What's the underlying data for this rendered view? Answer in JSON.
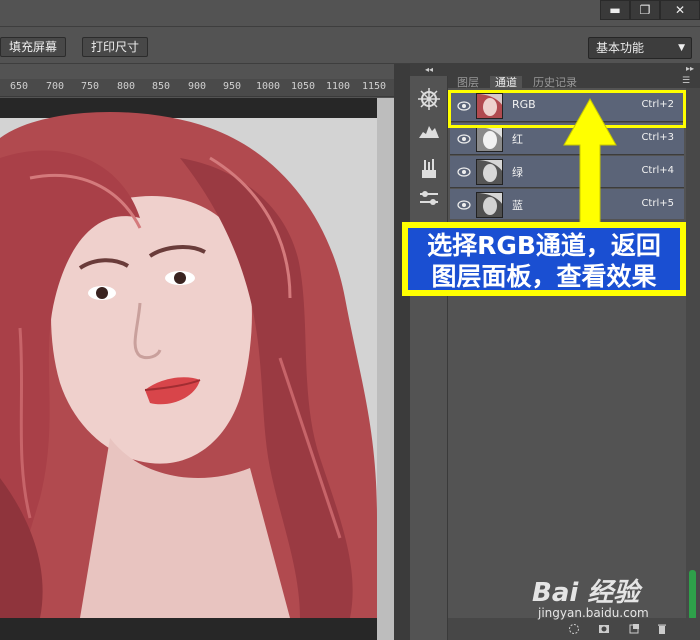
{
  "window": {
    "minimize": "▬",
    "restore": "❐",
    "close": "✕"
  },
  "options": {
    "fill_screen": "填充屏幕",
    "print_size": "打印尺寸",
    "workspace": "基本功能"
  },
  "ruler": {
    "ticks": [
      "650",
      "700",
      "750",
      "800",
      "850",
      "900",
      "950",
      "1000",
      "1050",
      "1100",
      "1150"
    ]
  },
  "tools_collapse": "◂◂",
  "panel": {
    "collapse": "▸▸",
    "tabs": [
      "图层",
      "通道",
      "历史记录"
    ],
    "active_tab": "通道",
    "channels": [
      {
        "name": "RGB",
        "shortcut": "Ctrl+2"
      },
      {
        "name": "红",
        "shortcut": "Ctrl+3"
      },
      {
        "name": "绿",
        "shortcut": "Ctrl+4"
      },
      {
        "name": "蓝",
        "shortcut": "Ctrl+5"
      }
    ]
  },
  "annotation": {
    "line1": "选择RGB通道，返回",
    "line2": "图层面板，查看效果",
    "box_color": "#ffff00",
    "bg_color": "#1a4fd2"
  },
  "watermark": {
    "brand": "Bai 经验",
    "url": "jingyan.baidu.com"
  }
}
